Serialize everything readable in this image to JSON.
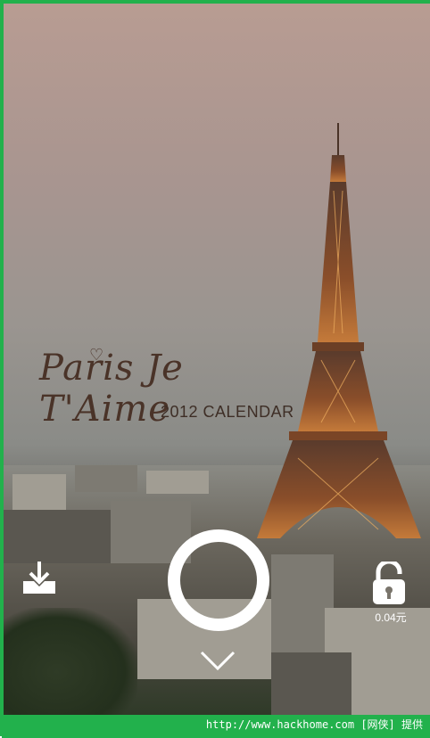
{
  "wallpaper": {
    "title_script": "Paris Je T'Aime",
    "title_sub": "2012 CALENDAR"
  },
  "controls": {
    "download_icon": "download-icon",
    "unlock_ring_icon": "unlock-ring-icon",
    "chevron_icon": "chevron-down-icon",
    "lock_icon": "unlocked-padlock-icon",
    "price": "0.04元"
  },
  "watermark": {
    "text": "http://www.hackhome.com [网侠] 提供"
  },
  "colors": {
    "frame": "#22b14c",
    "text_dark": "#4a3328",
    "white": "#ffffff"
  }
}
